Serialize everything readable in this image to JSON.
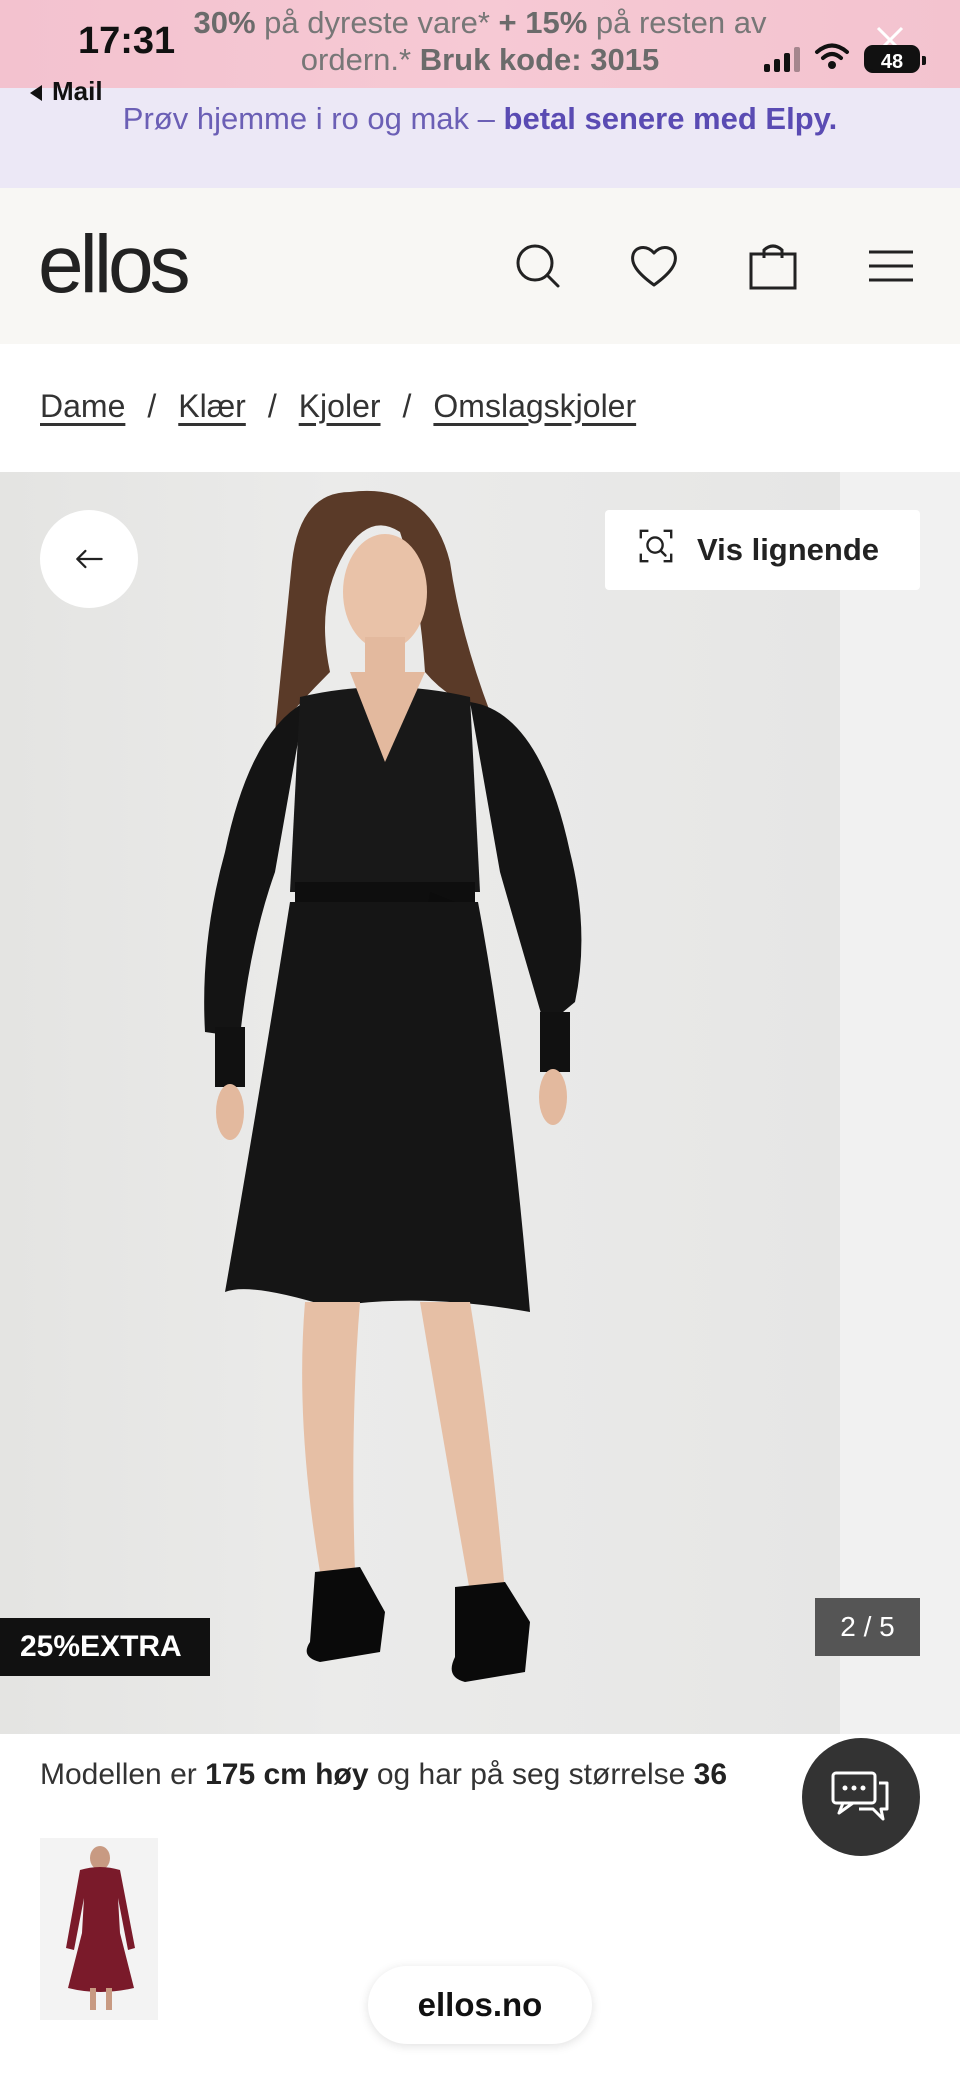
{
  "status_bar": {
    "time": "17:31",
    "back_app": "Mail",
    "battery": "48",
    "icons": [
      "signal-icon",
      "wifi-icon",
      "battery-icon"
    ]
  },
  "promo_banner": {
    "pct1": "30%",
    "text1": " på dyreste vare* ",
    "pct2": "+ 15%",
    "text2": " på resten av ordern.* ",
    "code": "Bruk kode: 3015"
  },
  "elpy_banner": {
    "text": "Prøv hjemme i ro og mak – ",
    "link": "betal senere med Elpy."
  },
  "header": {
    "logo": "ellos",
    "icons": [
      "search-icon",
      "heart-icon",
      "shopping-bag-icon",
      "menu-icon"
    ]
  },
  "breadcrumb": {
    "items": [
      "Dame",
      "Klær",
      "Kjoler",
      "Omslagskjoler"
    ],
    "separator": "/"
  },
  "gallery": {
    "similar_label": "Vis lignende",
    "badge": "25%EXTRA",
    "counter": "2 / 5"
  },
  "model_info": {
    "prefix": "Modellen er ",
    "height": "175 cm høy",
    "middle": " og har på seg størrelse ",
    "size": "36"
  },
  "footer": {
    "url": "ellos.no"
  },
  "colors": {
    "promo_bg": "#f6c9d4",
    "elpy_bg": "#ece8f6",
    "elpy_link": "#5a4bb3",
    "header_bg": "#f8f7f4",
    "badge_bg": "#111111"
  }
}
